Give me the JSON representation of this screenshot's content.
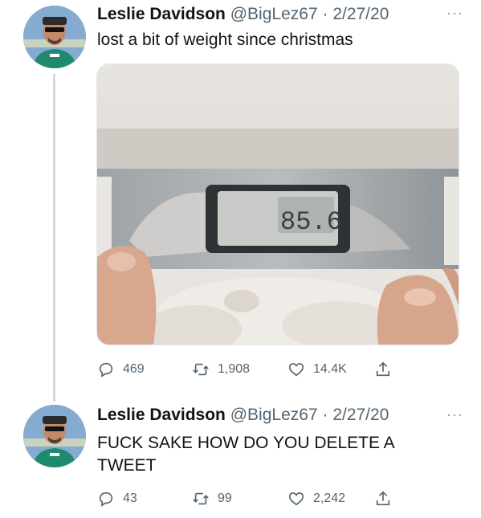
{
  "tweets": [
    {
      "author_name": "Leslie Davidson",
      "handle": "@BigLez67",
      "separator": "·",
      "date": "2/27/20",
      "more": "···",
      "text": "lost a bit of weight since christmas",
      "stats": {
        "replies": "469",
        "retweets": "1,908",
        "likes": "14.4K"
      }
    },
    {
      "author_name": "Leslie Davidson",
      "handle": "@BigLez67",
      "separator": "·",
      "date": "2/27/20",
      "more": "···",
      "text": "FUCK SAKE HOW DO YOU DELETE A TWEET",
      "stats": {
        "replies": "43",
        "retweets": "99",
        "likes": "2,242"
      }
    }
  ],
  "icons": {
    "reply": "reply-icon",
    "retweet": "retweet-icon",
    "like": "like-icon",
    "share": "share-icon",
    "more": "more-icon"
  },
  "colors": {
    "text_primary": "#0f1419",
    "text_secondary": "#536471",
    "thread_line": "#cfd9de"
  }
}
